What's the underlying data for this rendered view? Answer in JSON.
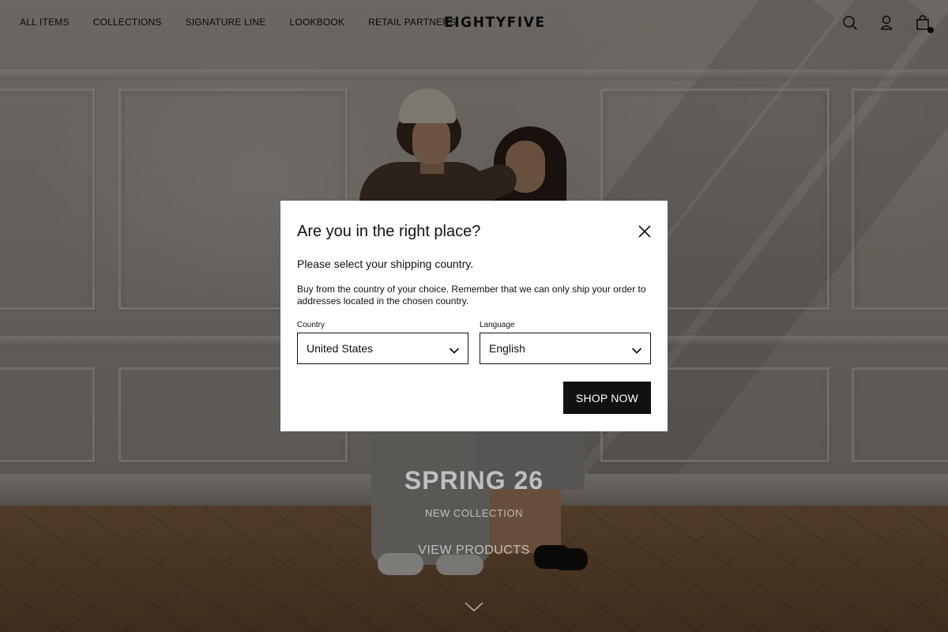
{
  "header": {
    "nav": [
      {
        "label": "ALL ITEMS"
      },
      {
        "label": "COLLECTIONS"
      },
      {
        "label": "SIGNATURE LINE"
      },
      {
        "label": "LOOKBOOK"
      },
      {
        "label": "RETAIL PARTNERS"
      }
    ],
    "logo": "EIGHTYFIVE",
    "icons": [
      "search-icon",
      "account-icon",
      "cart-icon"
    ]
  },
  "hero": {
    "title": "SPRING 26",
    "subtitle": "NEW COLLECTION",
    "cta": "VIEW PRODUCTS"
  },
  "modal": {
    "title": "Are you in the right place?",
    "lead": "Please select your shipping country.",
    "description": "Buy from the country of your choice. Remember that we can only ship your order to addresses located in the chosen country.",
    "country_label": "Country",
    "country_value": "United States",
    "language_label": "Language",
    "language_value": "English",
    "submit_label": "SHOP NOW"
  },
  "colors": {
    "text": "#111111",
    "button_bg": "#111111",
    "button_text": "#ffffff",
    "modal_bg": "#ffffff"
  }
}
